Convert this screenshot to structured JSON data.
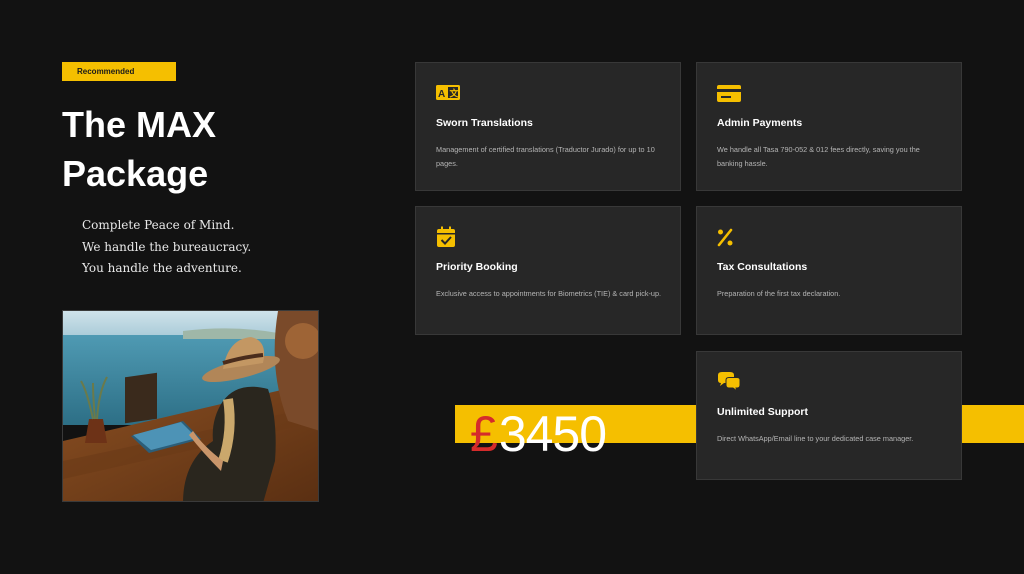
{
  "badge": "Recommended",
  "title_line1": "The MAX",
  "title_line2": "Package",
  "tagline": [
    "Complete Peace of Mind.",
    "We handle the bureaucracy.",
    "You handle the adventure."
  ],
  "price": {
    "currency": "£",
    "amount": "3450"
  },
  "accent_color": "#f5bf00",
  "services": [
    {
      "icon": "translate-icon",
      "title": "Sworn Translations",
      "desc": "Management of certified translations (Traductor Jurado) for up to 10 pages."
    },
    {
      "icon": "credit-card-icon",
      "title": "Admin Payments",
      "desc": "We handle all Tasa 790-052 & 012 fees directly, saving you the banking hassle."
    },
    {
      "icon": "calendar-check-icon",
      "title": "Priority Booking",
      "desc": "Exclusive access to appointments for Biometrics (TIE) & card pick-up."
    },
    {
      "icon": "percent-icon",
      "title": "Tax Consultations",
      "desc": "Preparation of the first tax declaration."
    },
    {
      "icon": "chat-bubbles-icon",
      "title": "Unlimited Support",
      "desc": "Direct WhatsApp/Email line to your dedicated case manager."
    }
  ]
}
